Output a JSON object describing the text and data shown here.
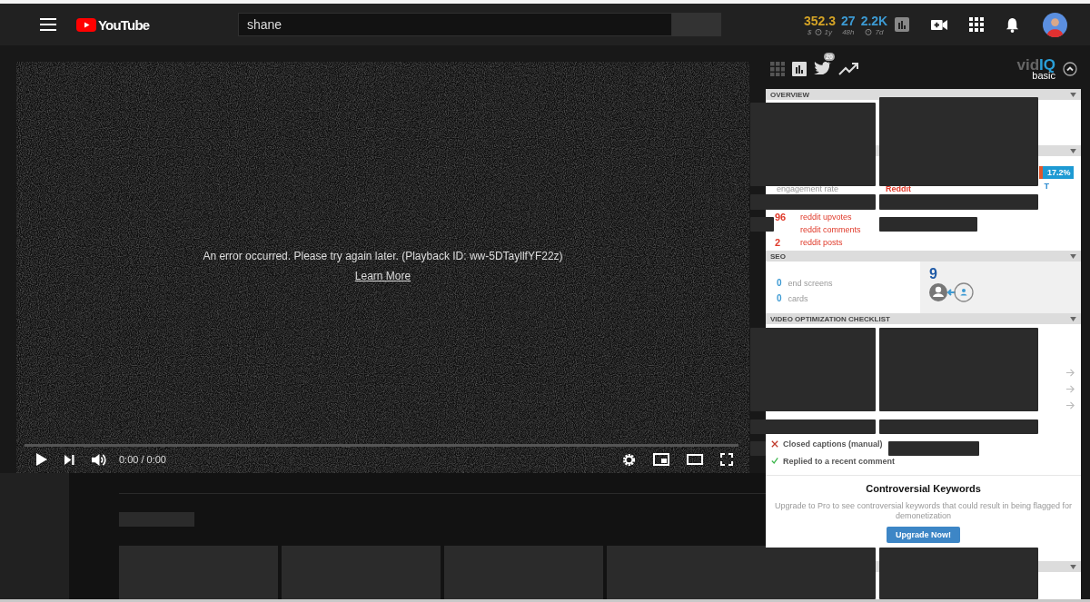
{
  "topbar": {
    "logo": "YouTube",
    "search": {
      "value": "shane"
    },
    "stats": [
      {
        "value": "352.3",
        "color": "#d4a326",
        "kind": "money",
        "prefix": "$",
        "caption": "1y"
      },
      {
        "value": "27",
        "color": "#3c9ad3",
        "kind": "plain",
        "caption": "48h"
      },
      {
        "value": "2.2K",
        "color": "#3c9ad3",
        "kind": "clock",
        "caption": "7d"
      }
    ]
  },
  "player": {
    "error": "An error occurred. Please try again later. (Playback ID: ww-5DTayllfYF22z)",
    "link": "Learn More",
    "time": "0:00 / 0:00",
    "progress": {
      "level": 0
    }
  },
  "vidiq": {
    "twitter_badge": "20",
    "logo": {
      "left": "vid",
      "right": "IQ",
      "tier": "basic"
    },
    "overview": {
      "title": "OVERVIEW"
    },
    "engagement": {
      "percent": "17.2%",
      "percent_note": "T",
      "rate_label": "engagement rate",
      "source": "Reddit",
      "stats": [
        {
          "value": "96",
          "label": "reddit upvotes"
        },
        {
          "label": "reddit comments"
        },
        {
          "value": "2",
          "label": "reddit posts"
        }
      ]
    },
    "seo": {
      "title": "SEO",
      "counts": [
        {
          "value": "0",
          "label": "end screens"
        },
        {
          "value": "0",
          "label": "cards"
        }
      ],
      "subscribers": "9"
    },
    "checklist": {
      "title": "VIDEO OPTIMIZATION CHECKLIST",
      "items": [
        {
          "label": "Closed captions (manual)",
          "done": false
        },
        {
          "label": "Replied to a recent comment",
          "done": true
        }
      ]
    },
    "controversial": {
      "title": "Controversial Keywords",
      "text": "Upgrade to Pro to see controversial keywords that could result in being flagged for demonetization",
      "button": "Upgrade Now!"
    }
  }
}
